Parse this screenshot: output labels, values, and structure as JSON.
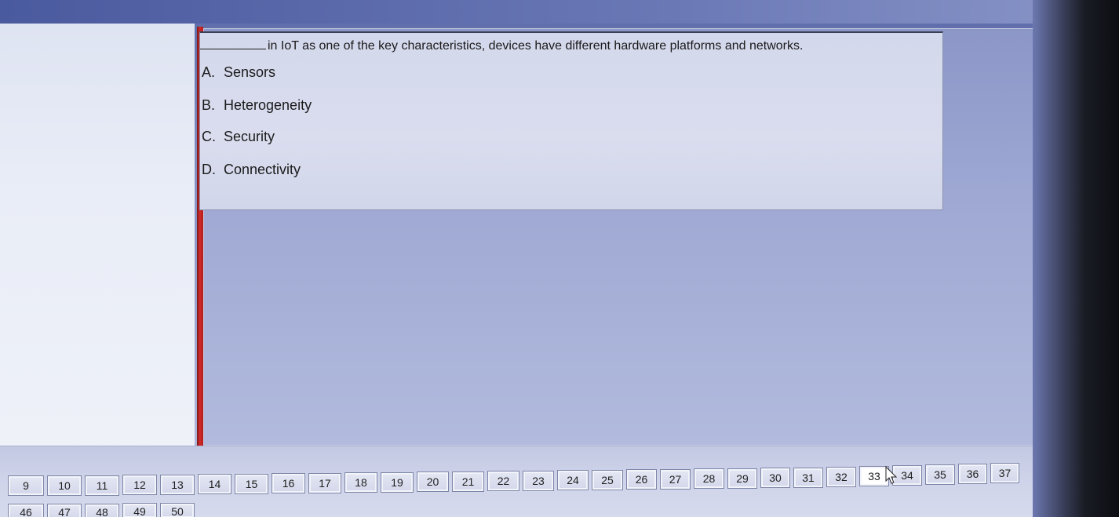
{
  "question": {
    "text": "in IoT as one of the key characteristics, devices have different hardware platforms and networks.",
    "options": [
      {
        "letter": "A.",
        "label": "Sensors"
      },
      {
        "letter": "B.",
        "label": "Heterogeneity"
      },
      {
        "letter": "C.",
        "label": "Security"
      },
      {
        "letter": "D.",
        "label": "Connectivity"
      }
    ]
  },
  "navigator": {
    "row1": [
      "9",
      "10",
      "11",
      "12",
      "13",
      "14",
      "15",
      "16",
      "17",
      "18",
      "19",
      "20",
      "21",
      "22",
      "23",
      "24",
      "25",
      "26",
      "27",
      "28",
      "29",
      "30",
      "31",
      "32",
      "33",
      "34",
      "35",
      "36",
      "37"
    ],
    "row2": [
      "46",
      "47",
      "48",
      "49",
      "50"
    ],
    "current": "33"
  },
  "icons": {
    "cursor": "mouse-pointer-icon"
  },
  "colors": {
    "divider": "#d22a2a",
    "content_bg": "#9ea8d3",
    "question_bg": "#d9ddee"
  }
}
